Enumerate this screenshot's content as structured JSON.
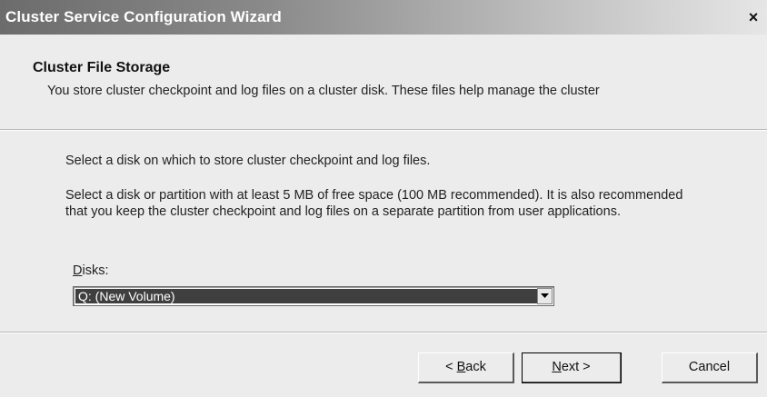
{
  "window": {
    "title": "Cluster Service Configuration Wizard",
    "close_glyph": "×"
  },
  "header": {
    "title": "Cluster File Storage",
    "description": "You store cluster checkpoint and log files on a cluster disk. These files help manage the cluster"
  },
  "body": {
    "instruction_1": "Select a disk on which to store cluster checkpoint and log files.",
    "instruction_2": "Select a disk or partition with at least 5 MB of free space (100 MB recommended). It is also recommended that you keep the cluster checkpoint and log files on a separate partition from user applications.",
    "disks_label_hotkey": "D",
    "disks_label_rest": "isks:",
    "disks_selected": "Q: (New Volume)"
  },
  "buttons": {
    "back_prefix": "< ",
    "back_hotkey": "B",
    "back_rest": "ack",
    "next_hotkey": "N",
    "next_rest": "ext >",
    "cancel": "Cancel"
  },
  "icons": {
    "close": "close-icon",
    "dropdown": "chevron-down-icon"
  },
  "colors": {
    "selection_background": "#3f3f3f",
    "dialog_background": "#ececec"
  }
}
